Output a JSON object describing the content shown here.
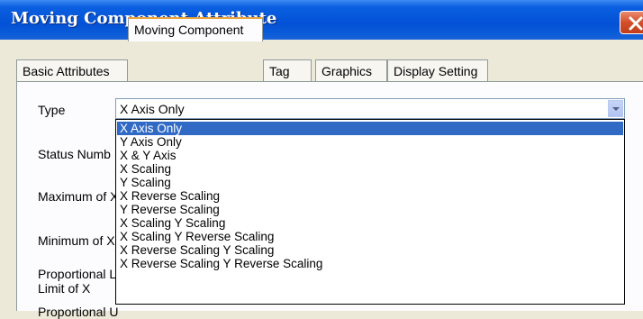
{
  "window": {
    "title": "Moving Component Attribute"
  },
  "tabs": [
    {
      "label": "Basic Attributes",
      "active": false
    },
    {
      "label": "Moving Component",
      "active": true
    },
    {
      "label": "Tag",
      "active": false
    },
    {
      "label": "Graphics",
      "active": false
    },
    {
      "label": "Display Setting",
      "active": false
    }
  ],
  "form": {
    "type_label": "Type",
    "status_label": "Status Numb",
    "max_label": "Maximum of X",
    "min_label": "Minimum of X",
    "prop_label_line1": "Proportional L",
    "prop_label_line2": "Limit of X",
    "partial_label": "Proportional U"
  },
  "type_combo": {
    "value": "X Axis Only",
    "options": [
      "X Axis Only",
      "Y Axis Only",
      "X & Y Axis",
      "X Scaling",
      "Y Scaling",
      "X Reverse Scaling",
      "Y Reverse Scaling",
      "X Scaling Y Scaling",
      "X Scaling Y Reverse Scaling",
      "X Reverse Scaling Y Scaling",
      "X Reverse Scaling Y Reverse Scaling"
    ],
    "selected_index": 0
  },
  "colors": {
    "titlebar": "#0351d6",
    "selection": "#316ac5",
    "active_tab_accent": "#e9a33c",
    "close_button": "#d34e2b"
  },
  "icons": {
    "close": "close-icon",
    "dropdown": "chevron-down-icon"
  }
}
